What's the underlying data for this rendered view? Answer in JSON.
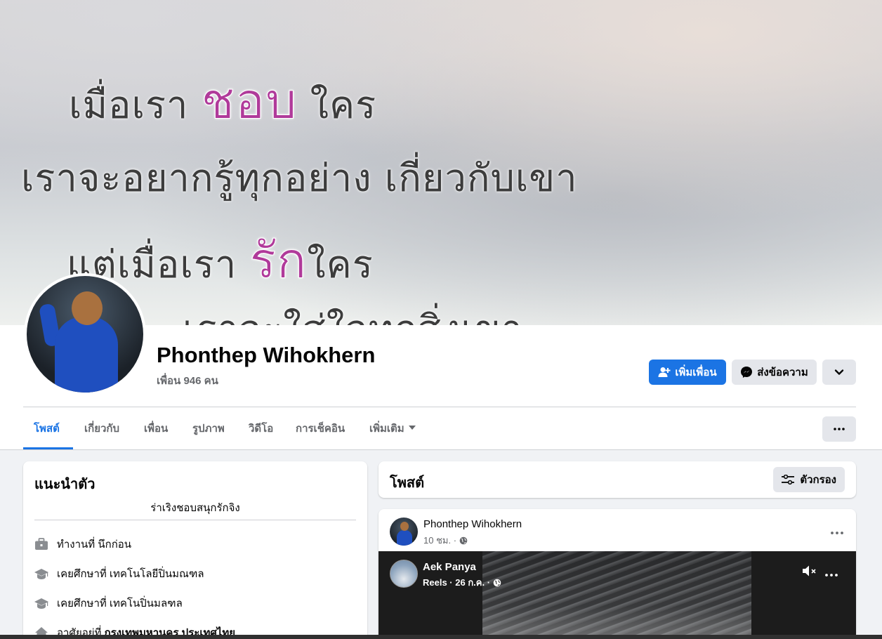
{
  "cover": {
    "lines": [
      {
        "pre": "เมื่อเรา ",
        "hl": "ชอบ",
        "post": " ใคร"
      },
      {
        "pre": "เราจะอยากรู้ทุกอย่าง  เกี่ยวกับเขา",
        "hl": "",
        "post": ""
      },
      {
        "pre": "แต่เมื่อเรา ",
        "hl": "รัก",
        "post": "ใคร"
      },
      {
        "pre": "เราจะใส่ใจทุกสิ่งเขา",
        "hl": "",
        "post": ""
      }
    ]
  },
  "profile": {
    "name": "Phonthep Wihokhern",
    "friends": "เพื่อน 946 คน"
  },
  "actions": {
    "add_friend": "เพิ่มเพื่อน",
    "message": "ส่งข้อความ"
  },
  "tabs": [
    {
      "label": "โพสต์"
    },
    {
      "label": "เกี่ยวกับ"
    },
    {
      "label": "เพื่อน"
    },
    {
      "label": "รูปภาพ"
    },
    {
      "label": "วิดีโอ"
    },
    {
      "label": "การเช็คอิน"
    },
    {
      "label": "เพิ่มเติม"
    }
  ],
  "intro": {
    "title": "แนะนำตัว",
    "bio": "ร่าเริงชอบสนุกรักจิง",
    "items": [
      {
        "icon": "briefcase-icon",
        "text": "ทำงานที่ นึกก่อน",
        "bold": ""
      },
      {
        "icon": "graduation-cap-icon",
        "text": "เคยศึกษาที่ เทคโนโลยีปิ่นมณฑล",
        "bold": ""
      },
      {
        "icon": "graduation-cap-icon",
        "text": "เคยศึกษาที่ เทคโนปิ่นมลฑล",
        "bold": ""
      },
      {
        "icon": "home-icon",
        "text": "อาศัยอยู่ที่ ",
        "bold": "กรุงเทพมหานคร ประเทศไทย"
      }
    ]
  },
  "posts": {
    "title": "โพสต์",
    "filter_label": "ตัวกรอง",
    "post": {
      "author": "Phonthep Wihokhern",
      "time": "10 ชม. ·",
      "reel": {
        "author": "Aek Panya",
        "meta": "Reels · 26 ก.ค. ·"
      }
    }
  },
  "colors": {
    "accent": "#1b74e4",
    "button_gray": "#e4e6eb",
    "background": "#f0f2f5"
  }
}
